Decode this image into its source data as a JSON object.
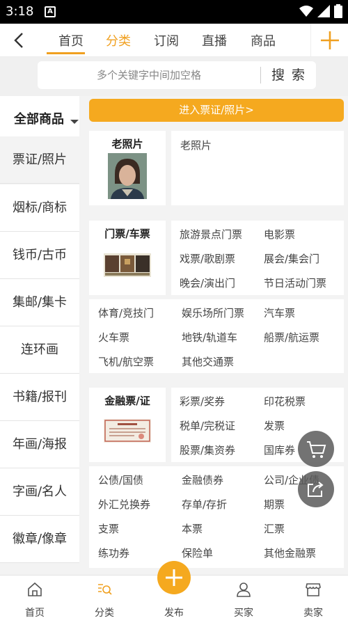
{
  "status_bar": {
    "time": "3:18",
    "notif_icon": "A"
  },
  "nav": {
    "tabs": [
      {
        "label": "首页"
      },
      {
        "label": "分类"
      },
      {
        "label": "订阅"
      },
      {
        "label": "直播"
      },
      {
        "label": "商品"
      }
    ]
  },
  "search": {
    "placeholder": "多个关键字中间加空格",
    "button": "搜 索"
  },
  "sidebar": {
    "header": "全部商品",
    "items": [
      "票证/照片",
      "烟标/商标",
      "钱币/古币",
      "集邮/集卡",
      "连环画",
      "书籍/报刊",
      "年画/海报",
      "字画/名人",
      "徽章/像章"
    ]
  },
  "banner": "进入票证/照片>",
  "groups": {
    "old_photo": {
      "title": "老照片",
      "items": [
        "老照片"
      ]
    },
    "tickets": {
      "title": "门票/车票",
      "items": [
        "旅游景点门票",
        "电影票",
        "戏票/歌剧票",
        "展会/集会门",
        "晚会/演出门",
        "节日活动门票",
        "体育/竞技门",
        "娱乐场所门票",
        "汽车票",
        "火车票",
        "地铁/轨道车",
        "船票/航运票",
        "飞机/航空票",
        "其他交通票"
      ]
    },
    "finance": {
      "title": "金融票/证",
      "items": [
        "彩票/奖券",
        "印花税票",
        "税单/完税证",
        "发票",
        "股票/集资券",
        "国库券",
        "公债/国债",
        "金融债券",
        "公司/企业债",
        "外汇兑换券",
        "存单/存折",
        "期票",
        "支票",
        "本票",
        "汇票",
        "练功券",
        "保险单",
        "其他金融票"
      ]
    }
  },
  "bottom": {
    "home": "首页",
    "category": "分类",
    "publish": "发布",
    "buyer": "买家",
    "seller": "卖家"
  },
  "colors": {
    "accent": "#f5a91f",
    "active_tab": "#f0a020"
  }
}
